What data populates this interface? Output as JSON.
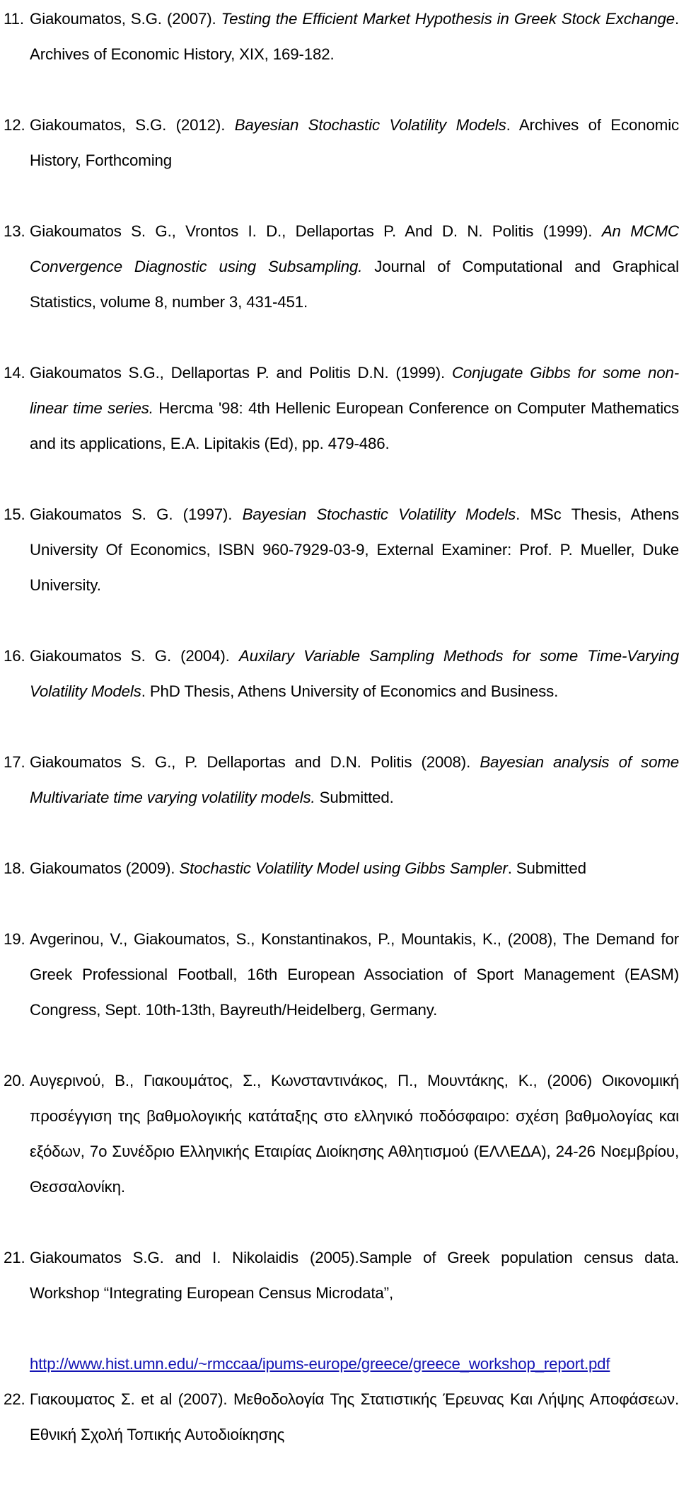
{
  "document": {
    "type": "reference-list",
    "link_color": "#1414b4",
    "text_color": "#000000",
    "background_color": "#ffffff"
  },
  "references": [
    {
      "number": "11.",
      "plain_text": "Giakoumatos, S.G. (2007). Testing the Efficient Market Hypothesis in Greek Stock Exchange. Archives of Economic History, XIX, 169-182.",
      "segments": [
        {
          "text": "Giakoumatos, S.G. (2007). ",
          "style": "normal"
        },
        {
          "text": "Testing the Efficient Market Hypothesis in Greek Stock Exchange",
          "style": "italic"
        },
        {
          "text": ". Archives of Economic History, XIX, 169-182.",
          "style": "normal"
        }
      ]
    },
    {
      "number": "12.",
      "plain_text": "Giakoumatos, S.G. (2012). Bayesian Stochastic Volatility Models. Archives of Economic History, Forthcoming",
      "segments": [
        {
          "text": "Giakoumatos, S.G. (2012). ",
          "style": "normal"
        },
        {
          "text": "Bayesian Stochastic Volatility Models",
          "style": "italic"
        },
        {
          "text": ". Archives of Economic History, Forthcoming",
          "style": "normal"
        }
      ]
    },
    {
      "number": "13.",
      "plain_text": "Giakoumatos S. G., Vrontos I. D., Dellaportas P. And D. N. Politis (1999). An MCMC Convergence Diagnostic using Subsampling.  Journal of Computational and Graphical Statistics, volume 8, number 3, 431-451.",
      "segments": [
        {
          "text": "Giakoumatos S. G., Vrontos I. D., Dellaportas P. And D. N. Politis (1999). ",
          "style": "normal"
        },
        {
          "text": "An MCMC Convergence Diagnostic using Subsampling.",
          "style": "italic"
        },
        {
          "text": "  Journal of Computational and Graphical Statistics, volume 8, number 3, 431-451.",
          "style": "normal"
        }
      ]
    },
    {
      "number": "14.",
      "plain_text": "Giakoumatos S.G., Dellaportas P. and Politis D.N. (1999).  Conjugate Gibbs for some non-linear time series.  Hercma '98: 4th Hellenic European Conference on Computer Mathematics and its applications, E.A. Lipitakis (Ed), pp. 479-486.",
      "segments": [
        {
          "text": "Giakoumatos S.G., Dellaportas P. and Politis D.N. (1999).  ",
          "style": "normal"
        },
        {
          "text": "Conjugate Gibbs for some non-linear time series.",
          "style": "italic"
        },
        {
          "text": "  Hercma '98: 4th Hellenic European Conference on Computer Mathematics and its applications, E.A. Lipitakis (Ed), pp. 479-486.",
          "style": "normal"
        }
      ]
    },
    {
      "number": "15.",
      "plain_text": "Giakoumatos S. G. (1997). Bayesian Stochastic Volatility Models. MSc Thesis, Athens University Of Economics, ISBN 960-7929-03-9, External Examiner: Prof. P. Mueller, Duke University.",
      "segments": [
        {
          "text": "Giakoumatos S. G. (1997). ",
          "style": "normal"
        },
        {
          "text": "Bayesian Stochastic Volatility Models",
          "style": "italic"
        },
        {
          "text": ". MSc Thesis, Athens University Of Economics, ISBN 960-7929-03-9, External Examiner: Prof. P. Mueller, Duke University.",
          "style": "normal"
        }
      ]
    },
    {
      "number": "16.",
      "plain_text": "Giakoumatos S. G. (2004). Auxilary Variable Sampling Methods for some Time-Varying Volatility Models. PhD Thesis, Athens University of Economics and Business.",
      "segments": [
        {
          "text": "Giakoumatos S. G. (2004). ",
          "style": "normal"
        },
        {
          "text": "Auxilary Variable Sampling Methods for some Time-Varying Volatility Models",
          "style": "italic"
        },
        {
          "text": ". PhD Thesis, Athens University of Economics and Business.",
          "style": "normal"
        }
      ]
    },
    {
      "number": "17.",
      "plain_text": "Giakoumatos S. G., P. Dellaportas and D.N. Politis (2008). Bayesian analysis of some Multivariate time varying volatility models. Submitted.",
      "segments": [
        {
          "text": "Giakoumatos S. G., P. Dellaportas and D.N. Politis (2008). ",
          "style": "normal"
        },
        {
          "text": "Bayesian analysis of some Multivariate time varying volatility models.",
          "style": "italic"
        },
        {
          "text": " Submitted.",
          "style": "normal"
        }
      ]
    },
    {
      "number": "18.",
      "plain_text": "Giakoumatos (2009). Stochastic Volatility Model using Gibbs Sampler. Submitted",
      "segments": [
        {
          "text": "Giakoumatos (2009). ",
          "style": "normal"
        },
        {
          "text": "Stochastic Volatility Model using Gibbs Sampler",
          "style": "italic"
        },
        {
          "text": ". Submitted",
          "style": "normal"
        }
      ]
    },
    {
      "number": "19.",
      "plain_text": "Avgerinou, V., Giakoumatos, S., Konstantinakos, P., Mountakis, K., (2008), The Demand for Greek Professional Football, 16th European Association of Sport Management (EASM) Congress, Sept. 10th-13th, Bayreuth/Heidelberg, Germany.",
      "segments": [
        {
          "text": "Avgerinou, V., Giakoumatos, S., Konstantinakos, P., Mountakis, K., (2008), The Demand for Greek Professional Football, 16th European Association of Sport Management (EASM) Congress, Sept. 10th-13th, Bayreuth/Heidelberg, Germany.",
          "style": "normal"
        }
      ]
    },
    {
      "number": "20.",
      "plain_text": "Αυγερινού, Β., Γιακουμάτος, Σ., Κωνσταντινάκος, Π., Μουντάκης, Κ., (2006) Οικονομική προσέγγιση της βαθμολογικής κατάταξης στο ελληνικό ποδόσφαιρο: σχέση βαθμολογίας και εξόδων, 7ο Συνέδριο Ελληνικής Εταιρίας Διοίκησης Αθλητισμού (ΕΛΛΕΔΑ), 24-26 Νοεμβρίου, Θεσσαλονίκη.",
      "segments": [
        {
          "text": "Αυγερινού, Β., Γιακουμάτος, Σ., Κωνσταντινάκος, Π., Μουντάκης, Κ., (2006) Οικονομική προσέγγιση της βαθμολογικής κατάταξης στο ελληνικό ποδόσφαιρο: σχέση βαθμολογίας και εξόδων, 7ο Συνέδριο Ελληνικής Εταιρίας Διοίκησης Αθλητισμού (ΕΛΛΕΔΑ), 24-26 Νοεμβρίου, Θεσσαλονίκη.",
          "style": "normal"
        }
      ]
    },
    {
      "number": "21.",
      "plain_text": "Giakoumatos S.G. and I. Nikolaidis (2005).Sample of Greek population census data. Workshop “Integrating European Census Microdata”,",
      "segments": [
        {
          "text": "Giakoumatos S.G. and I. Nikolaidis (2005).Sample of Greek population census data. Workshop “Integrating European Census Microdata”,",
          "style": "normal"
        }
      ],
      "url": "http://www.hist.umn.edu/~rmccaa/ipums-europe/greece/greece_workshop_report.pdf"
    },
    {
      "number": "22.",
      "plain_text": "Γιακουματος Σ. et al (2007). Μεθοδολογία Της Στατιστικής Έρευνας Και Λήψης Αποφάσεων. Εθνική Σχολή Τοπικής Αυτοδιοίκησης",
      "segments": [
        {
          "text": "Γιακουματος Σ. et al (2007). Μεθοδολογία Της Στατιστικής Έρευνας Και Λήψης Αποφάσεων. Εθνική Σχολή Τοπικής Αυτοδιοίκησης",
          "style": "normal"
        }
      ]
    }
  ]
}
